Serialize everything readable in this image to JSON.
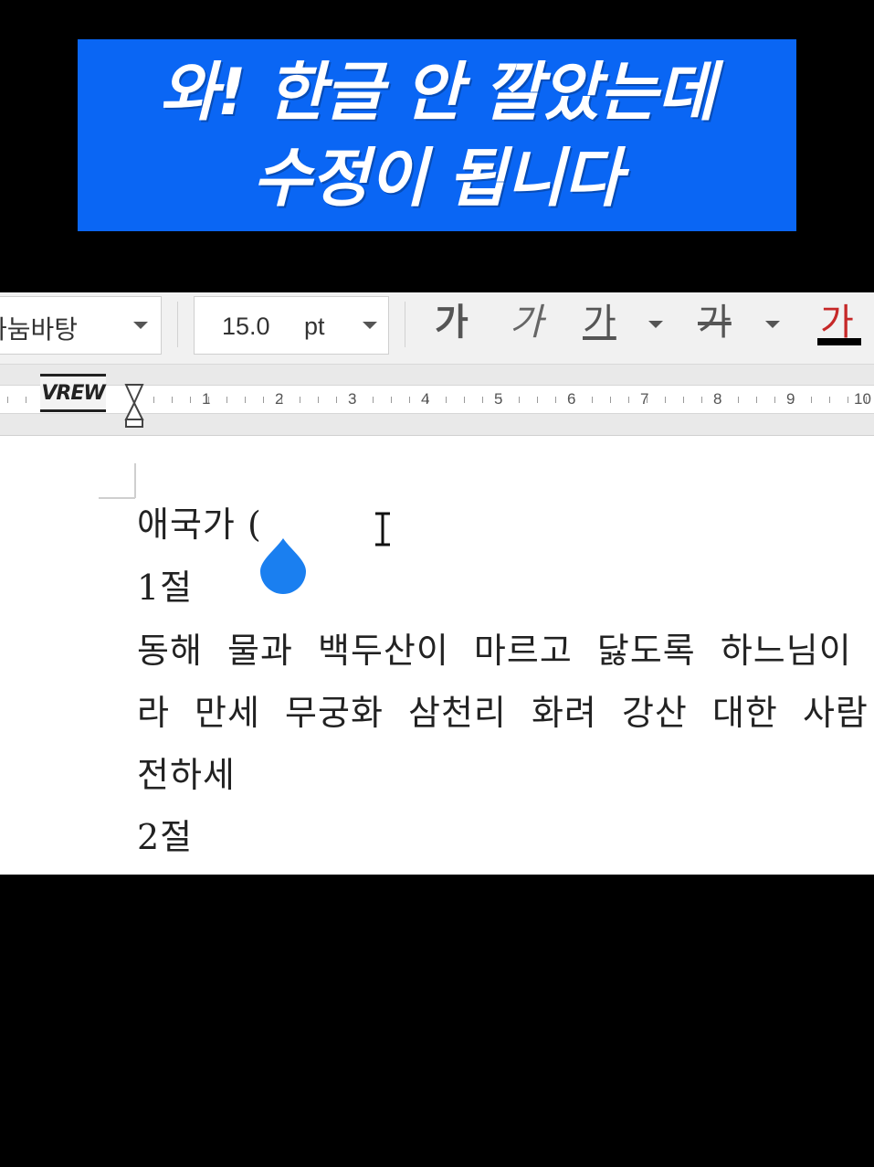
{
  "caption": {
    "line1": "와! 한글 안 깔았는데",
    "line2": "수정이 됩니다",
    "background": "#0a66f4",
    "text_color": "#ffffff"
  },
  "toolbar": {
    "font_name": "나눔바탕",
    "font_size_value": "15.0",
    "font_size_unit": "pt",
    "bold_label": "가",
    "italic_label": "가",
    "underline_label": "가",
    "strike_label": "가",
    "color_label": "가",
    "text_color": "#000000"
  },
  "ruler": {
    "numbers": [
      "1",
      "2",
      "3",
      "4",
      "5",
      "6",
      "7",
      "8",
      "9",
      "10"
    ],
    "watermark": "VREW"
  },
  "document": {
    "lines": [
      "애국가 (",
      "1절",
      "동해 물과 백두산이 마르고 닳도록 하느님이 보우하사 우리나",
      "라 만세 무궁화 삼천리 화려 강산 대한 사람 대한으로 길이 보",
      "전하세",
      "2절"
    ]
  },
  "cursor": {
    "type": "i-beam",
    "selection_handle": "drop-handle",
    "handle_color": "#1a7ff0"
  }
}
